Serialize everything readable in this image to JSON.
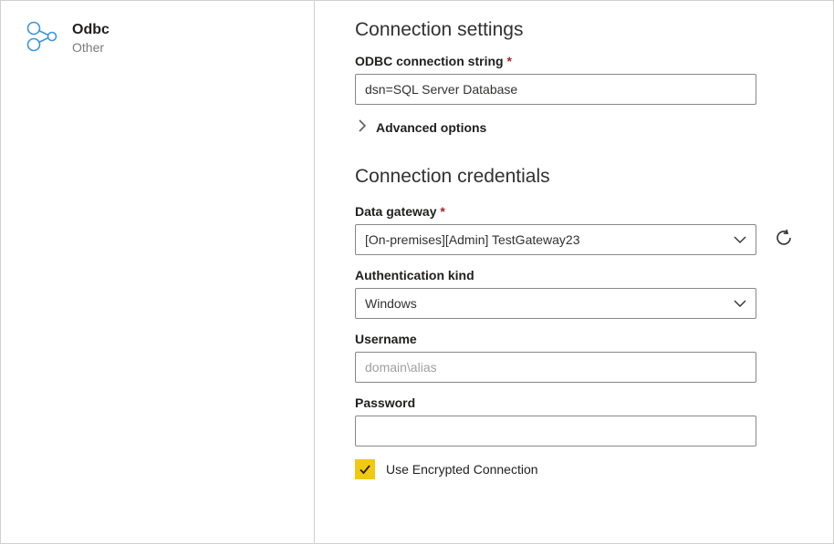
{
  "side": {
    "title": "Odbc",
    "subtitle": "Other"
  },
  "settings": {
    "heading": "Connection settings",
    "conn_label": "ODBC connection string",
    "conn_required": "*",
    "conn_value": "dsn=SQL Server Database",
    "advanced": "Advanced options"
  },
  "credentials": {
    "heading": "Connection credentials",
    "gateway_label": "Data gateway",
    "gateway_required": "*",
    "gateway_value": "[On-premises][Admin] TestGateway23",
    "auth_label": "Authentication kind",
    "auth_value": "Windows",
    "username_label": "Username",
    "username_placeholder": "domain\\alias",
    "password_label": "Password",
    "encrypted_label": "Use Encrypted Connection"
  },
  "colors": {
    "accent": "#f2c811",
    "border": "#8a8886",
    "icon_blue": "#3a96dd"
  }
}
